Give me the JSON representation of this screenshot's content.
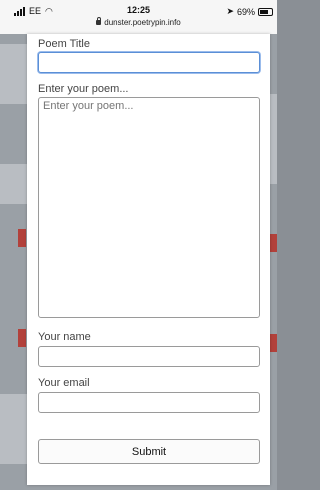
{
  "status_bar": {
    "carrier": "EE",
    "time": "12:25",
    "url": "dunster.poetrypin.info",
    "battery": "69%"
  },
  "form": {
    "title_label": "Poem Title",
    "title_value": "",
    "poem_placeholder": "Enter your poem...",
    "name_label": "Your name",
    "name_value": "",
    "email_label": "Your email",
    "email_value": "",
    "submit_label": "Submit"
  },
  "colors": {
    "focus_border": "#5b8fd6",
    "background_accent": "#b2413b"
  },
  "icons": [
    "signal-bars-icon",
    "wifi-icon",
    "lock-icon",
    "location-arrow-icon",
    "battery-icon"
  ]
}
